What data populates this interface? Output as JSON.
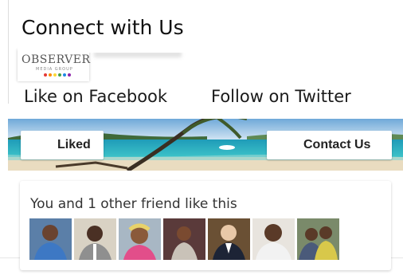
{
  "widget": {
    "title": "Connect with Us",
    "logo": {
      "name": "OBSERVER",
      "subtitle": "MEDIA GROUP",
      "dots": [
        "#e53935",
        "#fb8c00",
        "#fdd835",
        "#43a047",
        "#1e88e5",
        "#8e24aa"
      ]
    },
    "links": {
      "facebook": "Like on Facebook",
      "twitter": "Follow on Twitter"
    },
    "buttons": {
      "liked": "Liked",
      "contact": "Contact Us"
    },
    "friends": {
      "text": "You and 1 other friend like this",
      "avatar_count": 7
    }
  }
}
